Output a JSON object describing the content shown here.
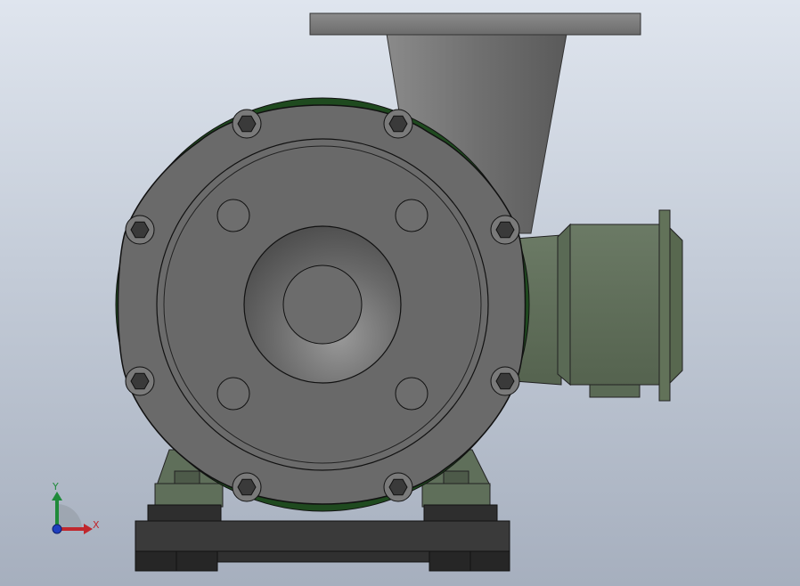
{
  "triad": {
    "x_label": "X",
    "y_label": "Y",
    "x_color": "#c0272d",
    "y_color": "#1f8a3a",
    "z_color": "#1f3fbf"
  },
  "colors": {
    "casing": "#6a6a6a",
    "motor": "#5f6f5a",
    "gasket": "#1f4a1f",
    "base": "#2a2a2a",
    "discharge": "#7a7a7a"
  },
  "parts": {
    "bolt_count": 8,
    "face_hole_count": 4
  }
}
